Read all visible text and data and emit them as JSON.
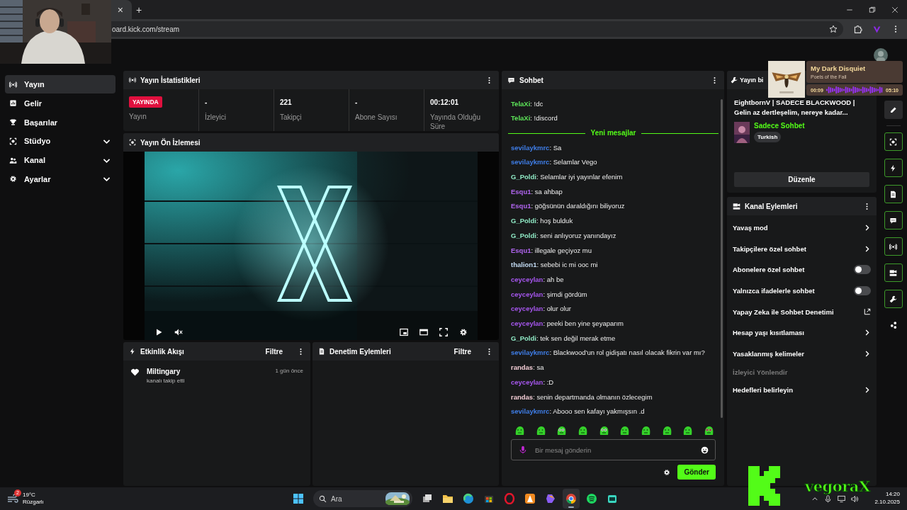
{
  "browser": {
    "tab_close": "×",
    "new_tab": "+",
    "url": "oard.kick.com/stream"
  },
  "sidebar": {
    "items": [
      {
        "label": "Yayın",
        "kind": "link",
        "selected": true
      },
      {
        "label": "Gelir",
        "kind": "link",
        "selected": false
      },
      {
        "label": "Başarılar",
        "kind": "link",
        "selected": false
      },
      {
        "label": "Stüdyo",
        "kind": "group",
        "selected": false,
        "expanded": false
      },
      {
        "label": "Kanal",
        "kind": "group",
        "selected": false,
        "expanded": false
      },
      {
        "label": "Ayarlar",
        "kind": "group",
        "selected": false,
        "expanded": false
      }
    ]
  },
  "stats": {
    "title": "Yayın İstatistikleri",
    "cells": [
      {
        "kind": "badge",
        "value": "YAYINDA",
        "label": "Yayın"
      },
      {
        "kind": "number",
        "value": "-",
        "label": "İzleyici"
      },
      {
        "kind": "number",
        "value": "221",
        "label": "Takipçi"
      },
      {
        "kind": "number",
        "value": "-",
        "label": "Abone Sayısı"
      },
      {
        "kind": "number",
        "value": "00:12:01",
        "label": "Yayında Olduğu Süre"
      }
    ]
  },
  "preview": {
    "title": "Yayın Ön İzlemesi"
  },
  "activity": {
    "title": "Etkinlik Akışı",
    "filter": "Filtre",
    "events": [
      {
        "user": "Miltingary",
        "action": "kanalı takip etti",
        "time": "1 gün önce"
      }
    ]
  },
  "moderation": {
    "title": "Denetim Eylemleri",
    "filter": "Filtre"
  },
  "chat": {
    "title": "Sohbet",
    "divider": "Yeni mesajlar",
    "earlier_messages": [
      {
        "user": "TelaXi",
        "color": "#5ee85a",
        "text": ": !dc"
      },
      {
        "user": "TelaXi",
        "color": "#5ee85a",
        "text": ": !discord"
      }
    ],
    "new_messages": [
      {
        "user": "sevilaykmrc",
        "color": "#3f7ee8",
        "text": ": Sa"
      },
      {
        "user": "sevilaykmrc",
        "color": "#3f7ee8",
        "text": ": Selamlar Vego"
      },
      {
        "user": "G_Poldi",
        "color": "#8fe8c4",
        "text": ": Selamlar iyi yayınlar efenim"
      },
      {
        "user": "Esqu1",
        "color": "#b165f0",
        "text": ": sa ahbap"
      },
      {
        "user": "Esqu1",
        "color": "#b165f0",
        "text": ": göğsünün daraldığını biliyoruz"
      },
      {
        "user": "G_Poldi",
        "color": "#8fe8c4",
        "text": ": hoş bulduk"
      },
      {
        "user": "G_Poldi",
        "color": "#8fe8c4",
        "text": ": seni anlıyoruz yanındayız"
      },
      {
        "user": "Esqu1",
        "color": "#b165f0",
        "text": ": illegale geçiyoz mu"
      },
      {
        "user": "thalion1",
        "color": "#c4dcf4",
        "text": ": sebebi ic mi ooc mi"
      },
      {
        "user": "ceyceylan",
        "color": "#a656ee",
        "text": ": ah be"
      },
      {
        "user": "ceyceylan",
        "color": "#a656ee",
        "text": ": şimdi gördüm"
      },
      {
        "user": "ceyceylan",
        "color": "#a656ee",
        "text": ": olur olur"
      },
      {
        "user": "ceyceylan",
        "color": "#a656ee",
        "text": ": peeki ben yine şeyaparım"
      },
      {
        "user": "G_Poldi",
        "color": "#8fe8c4",
        "text": ": tek sen değil merak etme"
      },
      {
        "user": "sevilaykmrc",
        "color": "#3f7ee8",
        "text": ": Blackwood'un rol gidişatı nasıl olacak fikrin var mı?"
      },
      {
        "user": "randas",
        "color": "#f2ccd4",
        "text": ": sa"
      },
      {
        "user": "ceyceylan",
        "color": "#a656ee",
        "text": ": :D"
      },
      {
        "user": "randas",
        "color": "#f2ccd4",
        "text": ": senin departmanda olmanın özlecegim"
      },
      {
        "user": "sevilaykmrc",
        "color": "#3f7ee8",
        "text": ": Abooo sen kafayı yakmışsın .d"
      }
    ],
    "input": {
      "placeholder": "Bir mesaj gönderin"
    },
    "send": "Gönder"
  },
  "stream_info": {
    "title": "Yayın bi",
    "stream_title_lines": [
      "EightbornV | SADECE BLACKWOOD |",
      "Gelin az dertleşelim, nereye kadar..."
    ],
    "category": "Sadece Sohbet",
    "tag": "Turkish",
    "edit": "Düzenle"
  },
  "channel_actions": {
    "title": "Kanal Eylemleri",
    "items": [
      {
        "label": "Yavaş mod",
        "kind": "arrow",
        "disabled": false
      },
      {
        "label": "Takipçilere özel sohbet",
        "kind": "arrow",
        "disabled": false
      },
      {
        "label": "Abonelere özel sohbet",
        "kind": "toggle",
        "on": false,
        "disabled": false
      },
      {
        "label": "Yalnızca ifadelerle sohbet",
        "kind": "toggle",
        "on": false,
        "disabled": false
      },
      {
        "label": "Yapay Zeka ile Sohbet Denetimi",
        "kind": "external",
        "disabled": false
      },
      {
        "label": "Hesap yaşı kısıtlaması",
        "kind": "arrow",
        "disabled": false
      },
      {
        "label": "Yasaklanmış kelimeler",
        "kind": "arrow",
        "disabled": false
      },
      {
        "label": "İzleyici Yönlendir",
        "kind": "plain",
        "disabled": true
      },
      {
        "label": "Hedefleri belirleyin",
        "kind": "arrow",
        "disabled": false
      }
    ]
  },
  "music": {
    "title": "My Dark Disquiet",
    "artist": "Poets of the Fall",
    "elapsed": "00:09",
    "duration": "05:10"
  },
  "overlay": {
    "brand": "vegoraX"
  },
  "taskbar": {
    "weather": {
      "badge": "2",
      "temp": "19°C",
      "condition": "Rüzgarlı"
    },
    "search": "Ara",
    "apps": [
      {
        "kind": "taskview",
        "selected": false
      },
      {
        "kind": "folder",
        "selected": false
      },
      {
        "kind": "edge",
        "selected": false
      },
      {
        "kind": "store",
        "selected": false
      },
      {
        "kind": "opera",
        "selected": false
      },
      {
        "kind": "cone",
        "selected": false
      },
      {
        "kind": "copilot",
        "selected": false
      },
      {
        "kind": "chrome",
        "selected": true
      },
      {
        "kind": "spotify",
        "selected": false
      },
      {
        "kind": "bot",
        "selected": false
      }
    ],
    "time": "14:20",
    "date": "2.10.2025"
  }
}
